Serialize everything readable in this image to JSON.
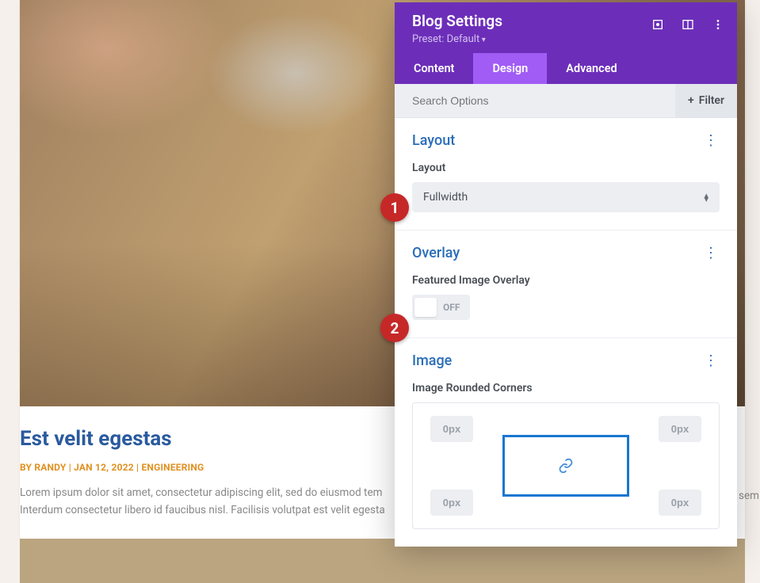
{
  "post": {
    "title": "Est velit egestas",
    "meta": "BY RANDY | JAN 12, 2022 | ENGINEERING",
    "excerpt_l1": "Lorem ipsum dolor sit amet, consectetur adipiscing elit, sed do eiusmod tem",
    "excerpt_l2": "Interdum consectetur libero id faucibus nisl. Facilisis volutpat est velit egesta",
    "excerpt_right": "sem"
  },
  "panel": {
    "title": "Blog Settings",
    "preset": "Preset: Default",
    "tabs": {
      "content": "Content",
      "design": "Design",
      "advanced": "Advanced"
    },
    "search_placeholder": "Search Options",
    "filter_label": "Filter"
  },
  "layout": {
    "section": "Layout",
    "label": "Layout",
    "value": "Fullwidth"
  },
  "overlay": {
    "section": "Overlay",
    "label": "Featured Image Overlay",
    "state": "OFF"
  },
  "image": {
    "section": "Image",
    "label": "Image Rounded Corners",
    "tl": "0px",
    "tr": "0px",
    "bl": "0px",
    "br": "0px"
  },
  "badges": {
    "one": "1",
    "two": "2"
  }
}
